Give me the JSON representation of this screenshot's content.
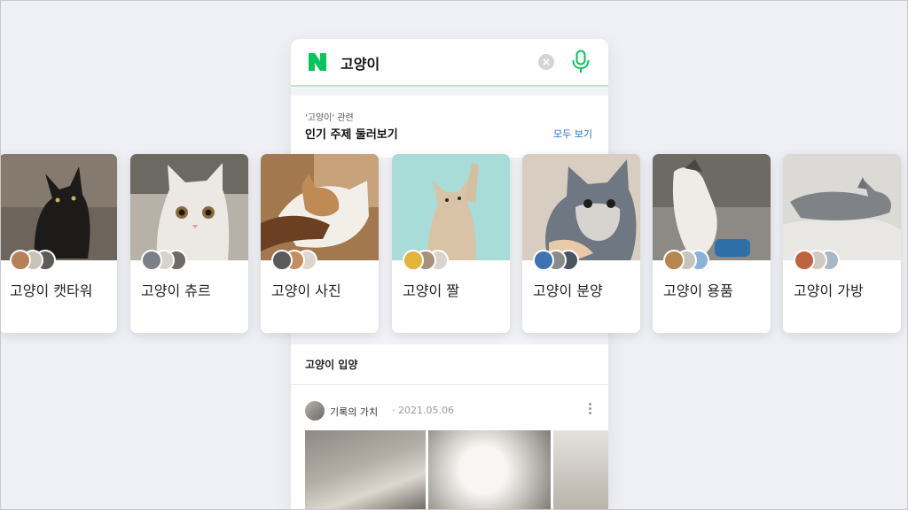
{
  "search": {
    "query": "고양이"
  },
  "topics_section": {
    "subtitle": "'고양이' 관련",
    "title": "인기 주제 둘러보기",
    "see_all": "모두 보기"
  },
  "topics": [
    {
      "label": "고양이 캣타워",
      "colors": [
        "#3b3a38",
        "#6b645c"
      ]
    },
    {
      "label": "고양이 츄르",
      "colors": [
        "#d7d0c8",
        "#8f8577"
      ]
    },
    {
      "label": "고양이 사진",
      "colors": [
        "#c2a078",
        "#6c4a2d"
      ]
    },
    {
      "label": "고양이 짤",
      "colors": [
        "#a6ddd9",
        "#5db6b0"
      ]
    },
    {
      "label": "고양이 분양",
      "colors": [
        "#d9cdc0",
        "#6e7b88"
      ]
    },
    {
      "label": "고양이 용품",
      "colors": [
        "#8f8c88",
        "#4e4b47"
      ]
    },
    {
      "label": "고양이 가방",
      "colors": [
        "#d8d6d3",
        "#8b8781"
      ]
    }
  ],
  "adopt_section": {
    "title": "고양이 입양",
    "post": {
      "author": "기록의 가치",
      "date": "· 2021.05.06"
    }
  }
}
